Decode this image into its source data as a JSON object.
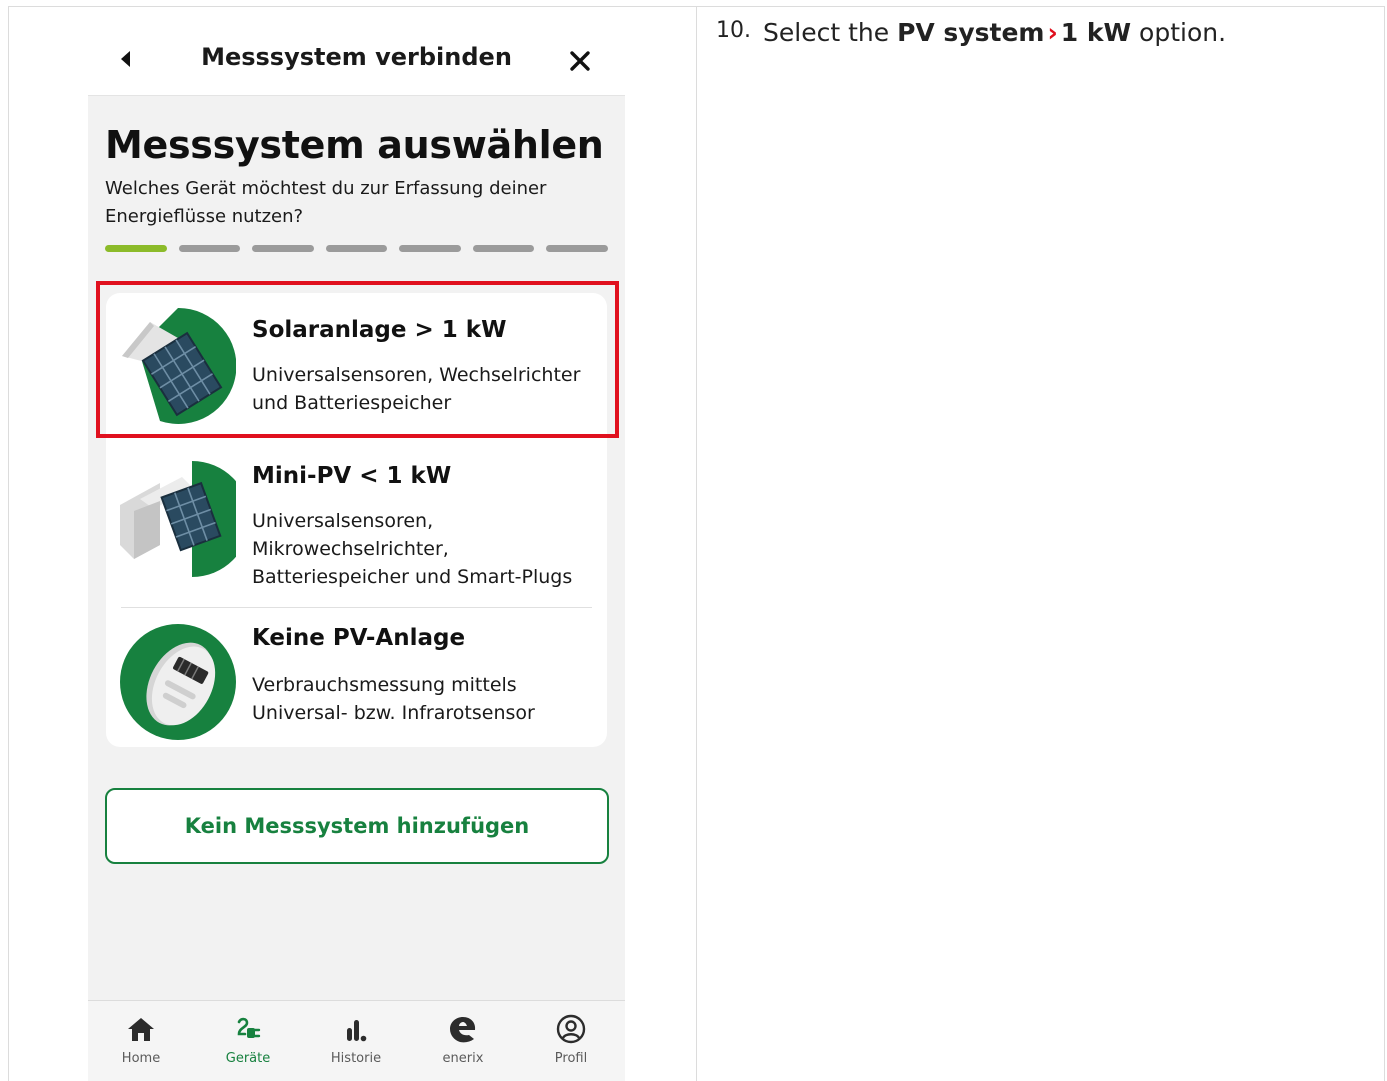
{
  "header": {
    "title": "Messsystem verbinden"
  },
  "page": {
    "title": "Messsystem auswählen",
    "subtitle": "Welches Gerät möchtest du zur Erfassung deiner Energieflüsse nutzen?",
    "progress": {
      "current_step": 1,
      "total_steps": 7
    }
  },
  "options": [
    {
      "title": "Solaranlage > 1 kW",
      "description": "Universalsensoren, Wechselrichter und Batteriespeicher",
      "icon": "solar-panel-icon",
      "highlighted": true
    },
    {
      "title": "Mini-PV < 1 kW",
      "description": "Universalsensoren, Mikrowechselrichter, Batteriespeicher und Smart-Plugs",
      "icon": "balcony-solar-icon",
      "highlighted": false
    },
    {
      "title": "Keine PV-Anlage",
      "description": "Verbrauchsmessung mittels Universal- bzw. Infrarotsensor",
      "icon": "energy-meter-icon",
      "highlighted": false
    }
  ],
  "secondary_button": {
    "label": "Kein Messsystem hinzufügen"
  },
  "bottom_nav": [
    {
      "label": "Home",
      "icon": "home-icon",
      "active": false
    },
    {
      "label": "Geräte",
      "icon": "plug-icon",
      "active": true
    },
    {
      "label": "Historie",
      "icon": "bar-chart-icon",
      "active": false
    },
    {
      "label": "enerix",
      "icon": "enerix-logo-icon",
      "active": false
    },
    {
      "label": "Profil",
      "icon": "user-circle-icon",
      "active": false
    }
  ],
  "instruction": {
    "step_number": "10.",
    "text_before": "Select the",
    "bold_1": "PV system",
    "separator": "›",
    "bold_2": "1 kW",
    "text_after": "option."
  },
  "colors": {
    "brand_green": "#17813f",
    "progress_active": "#8cbb2a",
    "progress_inactive": "#9b9b9b",
    "highlight_red": "#e0101e"
  }
}
